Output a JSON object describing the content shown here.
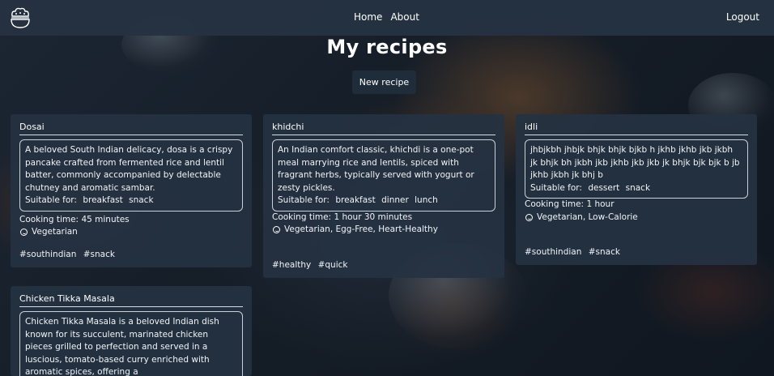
{
  "nav": {
    "links": [
      "Home",
      "About"
    ],
    "logout": "Logout"
  },
  "page": {
    "title": "My recipes",
    "new_recipe_label": "New recipe"
  },
  "labels": {
    "suitable_prefix": "Suitable for:",
    "cooking_prefix": "Cooking time:"
  },
  "recipes": [
    {
      "title": "Dosai",
      "description": "A beloved South Indian delicacy, dosa is a crispy pancake crafted from fermented rice and lentil batter, commonly accompanied by delectable chutney and aromatic sambar.",
      "suitable": [
        "breakfast",
        "snack"
      ],
      "cooking_time": "45 minutes",
      "diet": "Vegetarian",
      "tags": [
        "#southindian",
        "#snack"
      ]
    },
    {
      "title": "khidchi",
      "description": "An Indian comfort classic, khichdi is a one-pot meal marrying rice and lentils, spiced with fragrant herbs, typically served with yogurt or zesty pickles.",
      "suitable": [
        "breakfast",
        "dinner",
        "lunch"
      ],
      "cooking_time": "1 hour 30 minutes",
      "diet": "Vegetarian, Egg-Free, Heart-Healthy",
      "tags": [
        "#healthy",
        "#quick"
      ]
    },
    {
      "title": "idli",
      "description": "jhbjkbh jhbjk bhjk bhjk bjkb h jkhb jkhb jkb jkbh jk bhjk bh jkbh jkb jkhb jkb jkb jk bhjk bjk bjk b jb jkhb jkbh jk bhj b",
      "suitable": [
        "dessert",
        "snack"
      ],
      "cooking_time": "1 hour",
      "diet": "Vegetarian, Low-Calorie",
      "tags": [
        "#southindian",
        "#snack"
      ]
    },
    {
      "title": "Chicken Tikka Masala",
      "description": "Chicken Tikka Masala is a beloved Indian dish known for its succulent, marinated chicken pieces grilled to perfection and served in a luscious, tomato-based curry enriched with aromatic spices, offering a"
    }
  ]
}
